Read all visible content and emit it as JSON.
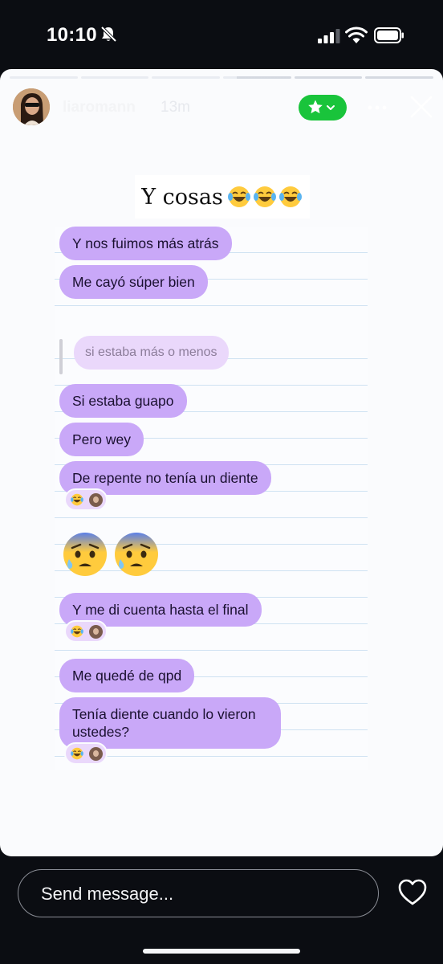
{
  "status_bar": {
    "time": "10:10",
    "icons": [
      "bell-slash-icon",
      "cellular-signal-icon",
      "wifi-icon",
      "battery-icon"
    ]
  },
  "story": {
    "segments_total": 6,
    "current_segment": 4,
    "current_progress": 0.2,
    "username": "liaromann",
    "time_ago": "13m",
    "close_friends_icon": "star-icon",
    "caption": "Y cosas",
    "caption_emoji": [
      "face-with-tears-of-joy",
      "face-with-tears-of-joy",
      "face-with-tears-of-joy"
    ]
  },
  "chat": {
    "messages": [
      {
        "text": "Y nos fuimos más atrás"
      },
      {
        "text": "Me cayó súper bien"
      },
      {
        "text": "Si estaba guapo"
      },
      {
        "text": "Pero wey"
      },
      {
        "text": "De repente no tenía un diente"
      },
      {
        "text": "Y me di cuenta hasta el final"
      },
      {
        "text": "Me quedé de qpd"
      },
      {
        "text": "Tenía diente cuando lo vieron ustedes?"
      }
    ],
    "quoted_reply": "si estaba más o menos",
    "big_emojis": [
      "anxious-face-with-sweat",
      "anxious-face-with-sweat"
    ],
    "reaction": [
      "face-with-tears-of-joy",
      "reactor-avatar"
    ]
  },
  "composer": {
    "placeholder": "Send message...",
    "like_icon": "heart-icon"
  },
  "colors": {
    "bubble": "#c9a8f8",
    "quote_bubble": "#ead8fb",
    "close_friends_green": "#19c43b",
    "background": "#0b0d12"
  }
}
